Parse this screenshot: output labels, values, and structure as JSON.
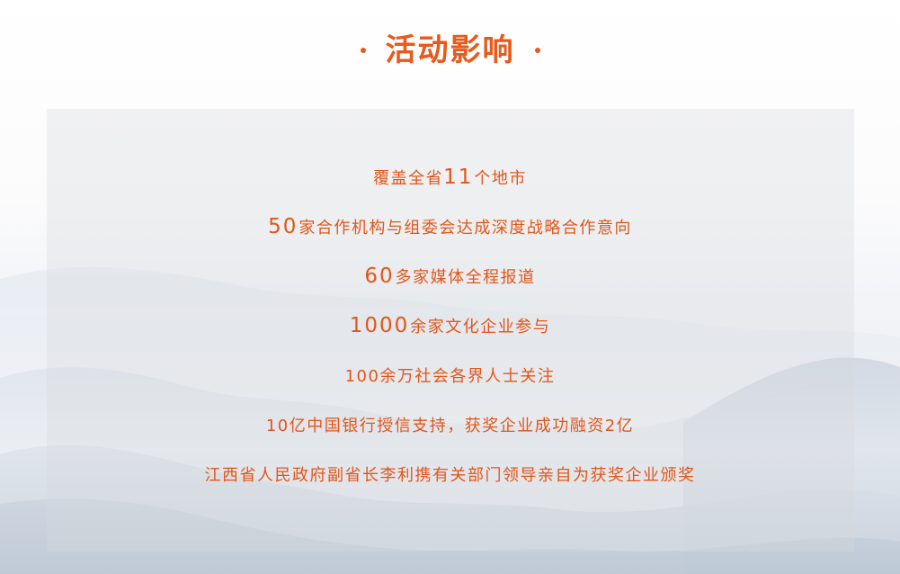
{
  "section": {
    "title": "活动影响"
  },
  "impacts": [
    {
      "number": "",
      "prefix": "覆盖全省",
      "inline_number": "11",
      "text": "个地市"
    },
    {
      "number": "50",
      "prefix": "",
      "inline_number": "",
      "text": "家合作机构与组委会达成深度战略合作意向"
    },
    {
      "number": "60",
      "prefix": "",
      "inline_number": "",
      "text": "多家媒体全程报道"
    },
    {
      "number": "1000",
      "prefix": "",
      "inline_number": "",
      "text": "余家文化企业参与"
    },
    {
      "number": "",
      "prefix": "",
      "inline_number": "",
      "text": "100余万社会各界人士关注"
    },
    {
      "number": "",
      "prefix": "",
      "inline_number": "",
      "text": "10亿中国银行授信支持，获奖企业成功融资2亿"
    },
    {
      "number": "",
      "prefix": "",
      "inline_number": "",
      "text": "江西省人民政府副省长李利携有关部门领导亲自为获奖企业颁奖"
    }
  ],
  "colors": {
    "accent": "#e85a1c",
    "panel": "#d6d8dc"
  }
}
